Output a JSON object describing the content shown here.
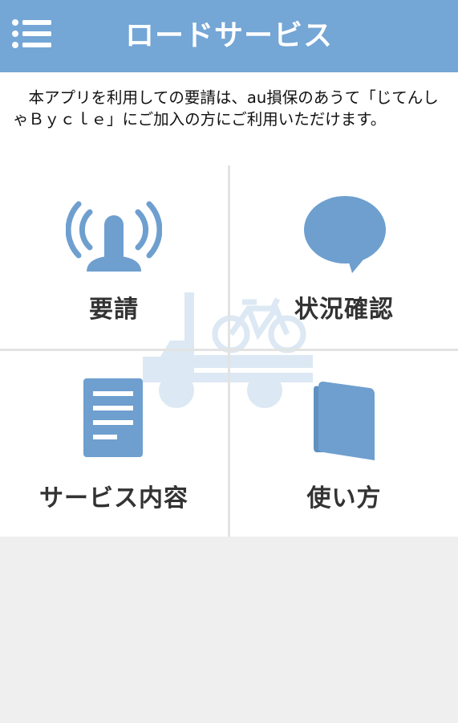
{
  "header": {
    "title": "ロードサービス",
    "menu_icon": "menu-list-icon",
    "bg_color": "#74a6d6"
  },
  "notice": {
    "text": "　本アプリを利用しての要請は、au損保のあうて「じてんしゃＢｙｃｌｅ」にご加入の方にご利用いただけます。"
  },
  "watermark": {
    "icon": "truck-with-bicycle-icon"
  },
  "tiles": [
    {
      "label": "要請",
      "icon": "signal-beacon-icon"
    },
    {
      "label": "状況確認",
      "icon": "speech-bubble-icon"
    },
    {
      "label": "サービス内容",
      "icon": "document-icon"
    },
    {
      "label": "使い方",
      "icon": "booklet-icon"
    }
  ],
  "colors": {
    "accent": "#74a6d6",
    "icon": "#6e9fcf",
    "label": "#333333",
    "background": "#efefef"
  }
}
